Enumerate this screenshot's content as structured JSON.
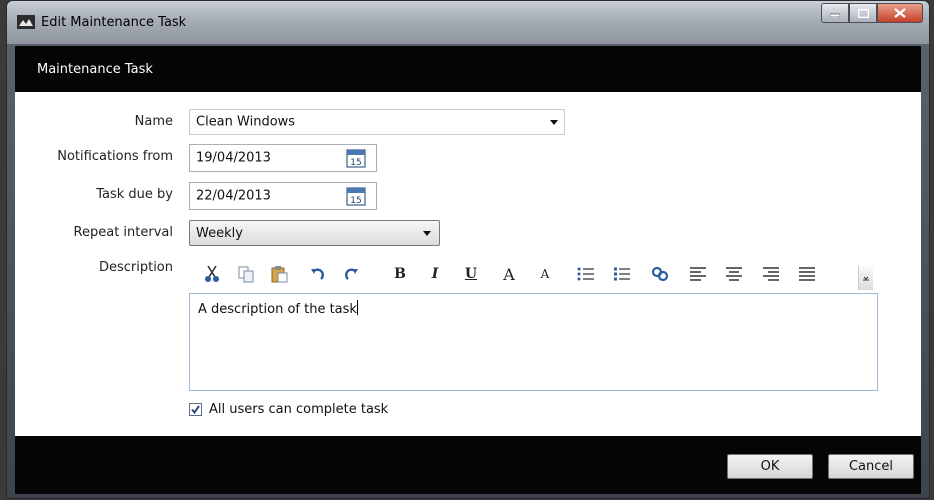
{
  "window": {
    "title": "Edit Maintenance Task"
  },
  "header": {
    "title": "Maintenance Task"
  },
  "form": {
    "name": {
      "label": "Name",
      "value": "Clean Windows"
    },
    "notifications_from": {
      "label": "Notifications from",
      "value": "19/04/2013",
      "calendar_day": "15"
    },
    "task_due_by": {
      "label": "Task due by",
      "value": "22/04/2013",
      "calendar_day": "15"
    },
    "repeat_interval": {
      "label": "Repeat interval",
      "value": "Weekly"
    },
    "description": {
      "label": "Description",
      "value": "A description of the task",
      "toolbar": {
        "bold": "B",
        "italic": "I",
        "underline": "U",
        "grow_font": "A",
        "shrink_font": "A"
      }
    },
    "all_users": {
      "label": "All users can complete task",
      "checked": true
    }
  },
  "footer": {
    "ok_label": "OK",
    "cancel_label": "Cancel"
  }
}
